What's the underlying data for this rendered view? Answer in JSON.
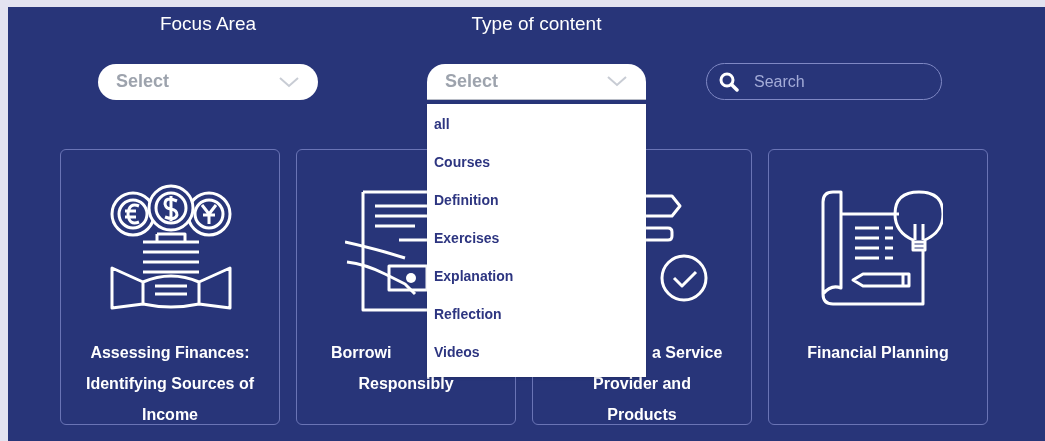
{
  "filters": [
    {
      "kind": "select",
      "label": "Focus Area",
      "value": "Select",
      "expanded": false
    },
    {
      "kind": "select",
      "label": "Type of content",
      "value": "Select",
      "expanded": true,
      "options": [
        {
          "label": "all",
          "selected": false
        },
        {
          "label": "Courses",
          "selected": false
        },
        {
          "label": "Definition",
          "selected": false
        },
        {
          "label": "Exercises",
          "selected": false
        },
        {
          "label": "Explanation",
          "selected": false
        },
        {
          "label": "Reflection",
          "selected": false
        },
        {
          "label": "Videos",
          "selected": false
        }
      ]
    },
    {
      "kind": "search",
      "placeholder": "Search"
    }
  ],
  "cards": [
    {
      "title_lines": [
        "Assessing Finances:",
        "Identifying Sources of",
        "Income"
      ]
    },
    {
      "title_lines": [
        "Borrowi",
        "Responsibly"
      ]
    },
    {
      "title_lines": [
        "a Service",
        "Provider and",
        "Products"
      ]
    },
    {
      "title_lines": [
        "Financial Planning"
      ]
    }
  ]
}
